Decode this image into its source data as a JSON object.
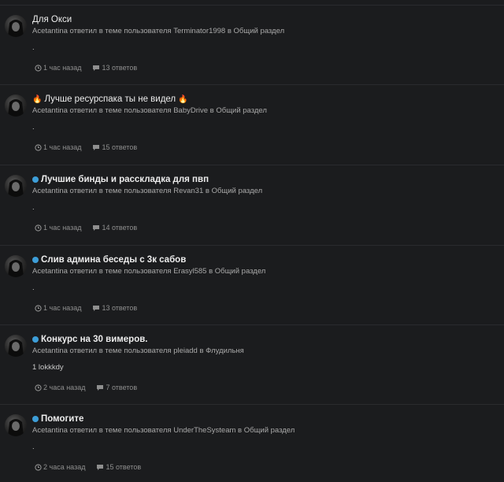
{
  "feed": {
    "items": [
      {
        "title": "Для Окси",
        "title_bold": false,
        "dot": false,
        "fire": false,
        "user": "Acetantina",
        "verb": "ответил в теме пользователя",
        "author": "Terminator1998",
        "in": "в",
        "forum": "Общий раздел",
        "snippet": ".",
        "time": "1 час назад",
        "replies": "13 ответов"
      },
      {
        "title": "Лучше ресурспака ты не видел",
        "title_bold": false,
        "dot": false,
        "fire": true,
        "user": "Acetantina",
        "verb": "ответил в теме пользователя",
        "author": "BabyDrive",
        "in": "в",
        "forum": "Общий раздел",
        "snippet": ".",
        "time": "1 час назад",
        "replies": "15 ответов"
      },
      {
        "title": "Лучшие бинды и расскладка для пвп",
        "title_bold": true,
        "dot": true,
        "fire": false,
        "user": "Acetantina",
        "verb": "ответил в теме пользователя",
        "author": "Revan31",
        "in": "в",
        "forum": "Общий раздел",
        "snippet": ".",
        "time": "1 час назад",
        "replies": "14 ответов"
      },
      {
        "title": "Слив админа беседы с 3к сабов",
        "title_bold": true,
        "dot": true,
        "fire": false,
        "user": "Acetantina",
        "verb": "ответил в теме пользователя",
        "author": "Erasyl585",
        "in": "в",
        "forum": "Общий раздел",
        "snippet": ".",
        "time": "1 час назад",
        "replies": "13 ответов"
      },
      {
        "title": "Конкурс на 30 вимеров.",
        "title_bold": true,
        "dot": true,
        "fire": false,
        "user": "Acetantina",
        "verb": "ответил в теме пользователя",
        "author": "pleiadd",
        "in": "в",
        "forum": "Флудильня",
        "snippet": "1 lokkkdy",
        "time": "2 часа назад",
        "replies": "7 ответов"
      },
      {
        "title": "Помогите",
        "title_bold": true,
        "dot": true,
        "fire": false,
        "user": "Acetantina",
        "verb": "ответил в теме пользователя",
        "author": "UnderTheSysteam",
        "in": "в",
        "forum": "Общий раздел",
        "snippet": ".",
        "time": "2 часа назад",
        "replies": "15 ответов"
      }
    ],
    "icons": {
      "avatar": "avatar-image",
      "clock": "clock-icon",
      "comment": "comment-icon",
      "fire": "fire-icon",
      "unread": "unread-dot-icon"
    },
    "colors": {
      "background": "#1b1c1e",
      "unread_dot": "#3d9ed8",
      "fire": "#ff6a1a",
      "title": "#ececec",
      "meta": "#a9a9a9"
    }
  }
}
